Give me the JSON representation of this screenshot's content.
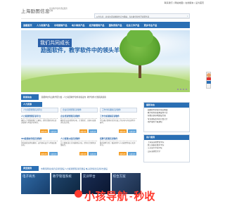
{
  "top_links": [
    "联系我们",
    "|",
    "网站地图",
    "|",
    "在线留言",
    "|",
    "设为首页"
  ],
  "logo": {
    "name": "上海励图信息",
    "tagline": "专业教学软件研发服务机构"
  },
  "notice": {
    "text": "公告信息：欢迎访问励图软件官方网站，专业教学软件开发服务商",
    "close": "×"
  },
  "nav": [
    "励图首页",
    "人力资源产品",
    "市场营销产品",
    "电子商务产品",
    "经济管理类产品",
    "国际贸易产品",
    "社会工作产品",
    "更多专业产品"
  ],
  "banner": {
    "line1": "我们共同成长",
    "line2": "励图软件，教学软件中的领头羊"
  },
  "news": {
    "label": "新闻动态",
    "text": "·励图举办专业教学研讨会    ·人力资源教学软件新版发布    ·教学软件大赛圆满落幕"
  },
  "sections": {
    "products_left": "人力资源",
    "products_mid": "市场营销",
    "side_news": "最新动态",
    "side_users": "用户案例"
  },
  "subtabs": [
    "人力资源管理实训平台",
    "企业培训管理实训软件",
    "工作分析模拟实训软件"
  ],
  "products": [
    {
      "title": "人力资源管理实训平台",
      "desc": "围绕人力资源管理六大模块，提供完整的岗位实训流程与考核评价体系。",
      "btn1": "查看详情",
      "btn2": "在线试用"
    },
    {
      "title": "企业培训管理实训软件",
      "desc": "模拟企业培训需求分析、计划制定、实施与效果评估全过程。",
      "btn1": "查看详情",
      "btn2": "在线试用"
    },
    {
      "title": "工作分析模拟实训软件",
      "desc": "学生通过情景化任务完成工作分析与岗位说明书编写。",
      "btn1": "查看详情",
      "btn2": "在线试用"
    },
    {
      "title": "360度绩效考核实训软件",
      "desc": "多维度绩效考核模拟，支持指标设计与考核结果分析。",
      "btn1": "查看详情",
      "btn2": "在线试用"
    },
    {
      "title": "人力资源沙盘实训软件",
      "desc": "以沙盘推演方式开展团队对抗，提升综合管理决策能力。",
      "btn1": "查看详情",
      "btn2": "在线试用"
    },
    {
      "title": "招聘与配置实训软件",
      "desc": "覆盖招聘计划、甄选测评与人员配置等核心实训环节。",
      "btn1": "查看详情",
      "btn2": "在线试用"
    }
  ],
  "side_news_items": [
    "励图软件参加全国高教展",
    "教学软件新版本发布公告",
    "院校实训基地建设方案",
    "专业课程改革研讨会召开",
    "用户服务升级通知"
  ],
  "side_users_items": [
    "上海某高校经管学院",
    "浙江某职业技术学院",
    "江苏某大学商学院",
    "山东某财经大学"
  ],
  "cases": {
    "label": "典型案例",
    "links": "市场营销专业综合实训室建设  人力资源管理实验室建设  电子商务综合实训平台建设"
  },
  "thumbs": [
    "电子商务",
    "教学管理系统",
    "实训平台",
    "综合方案"
  ],
  "watermark": {
    "main": "小孩导航",
    "sep": "-",
    "sec": "秒收"
  }
}
